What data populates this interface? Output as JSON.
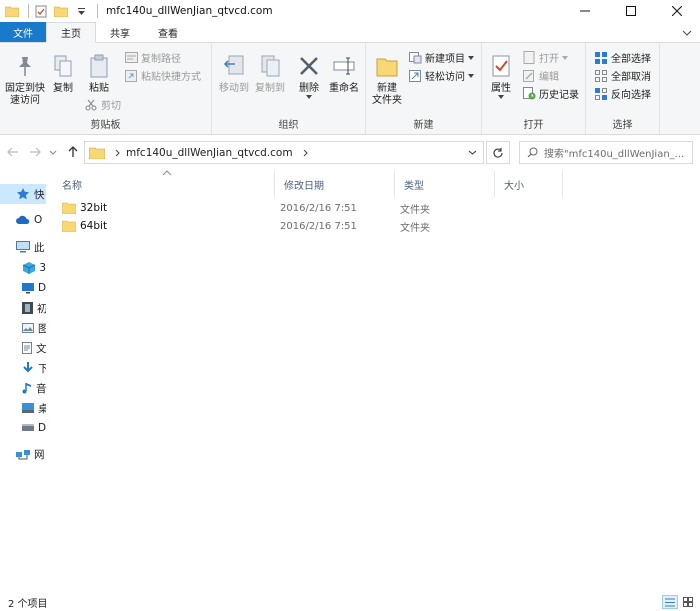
{
  "window": {
    "title": "mfc140u_dllWenJian_qtvcd.com"
  },
  "ribbon_tabs": [
    {
      "label": "文件"
    },
    {
      "label": "主页"
    },
    {
      "label": "共享"
    },
    {
      "label": "查看"
    }
  ],
  "ribbon": {
    "clipboard": {
      "label": "剪贴板",
      "pin_label": "固定到快\n速访问",
      "copy_label": "复制",
      "paste_label": "粘贴",
      "copy_path_label": "复制路径",
      "paste_shortcut_label": "粘贴快捷方式",
      "cut_label": "剪切"
    },
    "organize": {
      "label": "组织",
      "move_to_label": "移动到",
      "copy_to_label": "复制到",
      "delete_label": "删除",
      "rename_label": "重命名"
    },
    "new": {
      "label": "新建",
      "new_folder_label": "新建\n文件夹",
      "new_item_label": "新建项目",
      "easy_access_label": "轻松访问"
    },
    "open": {
      "label": "打开",
      "properties_label": "属性",
      "open_label": "打开",
      "edit_label": "编辑",
      "history_label": "历史记录"
    },
    "select": {
      "label": "选择",
      "select_all_label": "全部选择",
      "select_none_label": "全部取消",
      "invert_label": "反向选择"
    }
  },
  "address": {
    "path": "mfc140u_dllWenJian_qtvcd.com"
  },
  "search": {
    "placeholder": "搜索\"mfc140u_dllWenJian_..."
  },
  "nav_pane": {
    "items": [
      {
        "label": "快"
      },
      {
        "label": "O"
      },
      {
        "label": "此"
      },
      {
        "label": "3"
      },
      {
        "label": "D"
      },
      {
        "label": "初"
      },
      {
        "label": "图"
      },
      {
        "label": "文"
      },
      {
        "label": "下"
      },
      {
        "label": "音"
      },
      {
        "label": "桌"
      },
      {
        "label": "D"
      },
      {
        "label": "网"
      }
    ]
  },
  "columns": [
    {
      "label": "名称"
    },
    {
      "label": "修改日期"
    },
    {
      "label": "类型"
    },
    {
      "label": "大小"
    }
  ],
  "files": [
    {
      "name": "32bit",
      "date": "2016/2/16 7:51",
      "type": "文件夹",
      "size": ""
    },
    {
      "name": "64bit",
      "date": "2016/2/16 7:51",
      "type": "文件夹",
      "size": ""
    }
  ],
  "status": {
    "count": "2 个项目"
  },
  "colors": {
    "file_tab": "#1979ca",
    "folder": "#f8d775",
    "selected": "#cce8ff",
    "accent": "#0063b1"
  }
}
